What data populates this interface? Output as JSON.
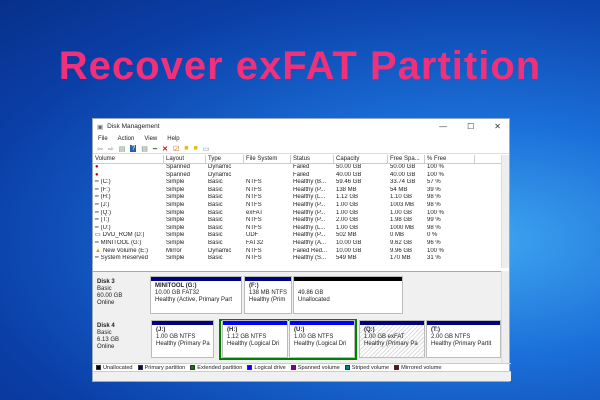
{
  "headline": "Recover exFAT Partition",
  "window": {
    "title": "Disk Management",
    "controls": [
      "—",
      "☐",
      "✕"
    ]
  },
  "menu": [
    "File",
    "Action",
    "View",
    "Help"
  ],
  "toolbar_icons": [
    "back-icon",
    "forward-icon",
    "disk-list-icon",
    "help-icon",
    "properties-icon",
    "connect-icon",
    "delete-icon",
    "check-icon",
    "new-folder-icon",
    "search-folder-icon",
    "view-icon"
  ],
  "columns": [
    "Volume",
    "Layout",
    "Type",
    "File System",
    "Status",
    "Capacity",
    "Free Spa...",
    "% Free"
  ],
  "rows": [
    [
      "",
      "Spanned",
      "Dynamic",
      "",
      "Failed",
      "50.00 GB",
      "50.00 GB",
      "100 %"
    ],
    [
      "",
      "Spanned",
      "Dynamic",
      "",
      "Failed",
      "40.00 GB",
      "40.00 GB",
      "100 %"
    ],
    [
      "(C:)",
      "Simple",
      "Basic",
      "NTFS",
      "Healthy (B...",
      "59.46 GB",
      "33.74 GB",
      "57 %"
    ],
    [
      "(F:)",
      "Simple",
      "Basic",
      "NTFS",
      "Healthy (P...",
      "138 MB",
      "54 MB",
      "39 %"
    ],
    [
      "(H:)",
      "Simple",
      "Basic",
      "NTFS",
      "Healthy (L...",
      "1.12 GB",
      "1.10 GB",
      "98 %"
    ],
    [
      "(J:)",
      "Simple",
      "Basic",
      "NTFS",
      "Healthy (P...",
      "1.00 GB",
      "1003 MB",
      "98 %"
    ],
    [
      "(Q:)",
      "Simple",
      "Basic",
      "exFAT",
      "Healthy (P...",
      "1.00 GB",
      "1.00 GB",
      "100 %"
    ],
    [
      "(T:)",
      "Simple",
      "Basic",
      "NTFS",
      "Healthy (P...",
      "2.00 GB",
      "1.98 GB",
      "99 %"
    ],
    [
      "(U:)",
      "Simple",
      "Basic",
      "NTFS",
      "Healthy (L...",
      "1.00 GB",
      "1000 MB",
      "98 %"
    ],
    [
      "DVD_ROM (D:)",
      "Simple",
      "Basic",
      "UDF",
      "Healthy (P...",
      "502 MB",
      "0 MB",
      "0 %"
    ],
    [
      "MINITOOL (G:)",
      "Simple",
      "Basic",
      "FAT32",
      "Healthy (A...",
      "10.00 GB",
      "9.62 GB",
      "96 %"
    ],
    [
      "New Volume (E:)",
      "Mirror",
      "Dynamic",
      "NTFS",
      "Failed Red...",
      "10.00 GB",
      "9.96 GB",
      "100 %"
    ],
    [
      "System Reserved",
      "Simple",
      "Basic",
      "NTFS",
      "Healthy (S...",
      "549 MB",
      "170 MB",
      "31 %"
    ]
  ],
  "disk3": {
    "name": "Disk 3",
    "type": "Basic",
    "size": "60.00 GB",
    "state": "Online",
    "parts": [
      [
        "MINITOOL  (G:)",
        "10.00 GB FAT32",
        "Healthy (Active, Primary Part"
      ],
      [
        "(F:)",
        "138 MB NTFS",
        "Healthy (Prim"
      ],
      [
        "",
        "49.86 GB",
        "Unallocated"
      ]
    ]
  },
  "disk4": {
    "name": "Disk 4",
    "type": "Basic",
    "size": "6.13 GB",
    "state": "Online",
    "parts": [
      [
        "(J:)",
        "1.00 GB NTFS",
        "Healthy (Primary Pa"
      ],
      [
        "(H:)",
        "1.12 GB NTFS",
        "Healthy (Logical Dri"
      ],
      [
        "(U:)",
        "1.00 GB NTFS",
        "Healthy (Logical Dri"
      ],
      [
        "(Q:)",
        "1.00 GB exFAT",
        "Healthy (Primary Pa"
      ],
      [
        "(T:)",
        "2.00 GB NTFS",
        "Healthy (Primary Partit"
      ]
    ]
  },
  "legend": [
    [
      "Unallocated",
      "#000000"
    ],
    [
      "Primary partition",
      "#00007f"
    ],
    [
      "Extended partition",
      "#008000"
    ],
    [
      "Logical drive",
      "#0000ff"
    ],
    [
      "Spanned volume",
      "#800080"
    ],
    [
      "Striped volume",
      "#008080"
    ],
    [
      "Mirrored volume",
      "#8b0000"
    ]
  ]
}
